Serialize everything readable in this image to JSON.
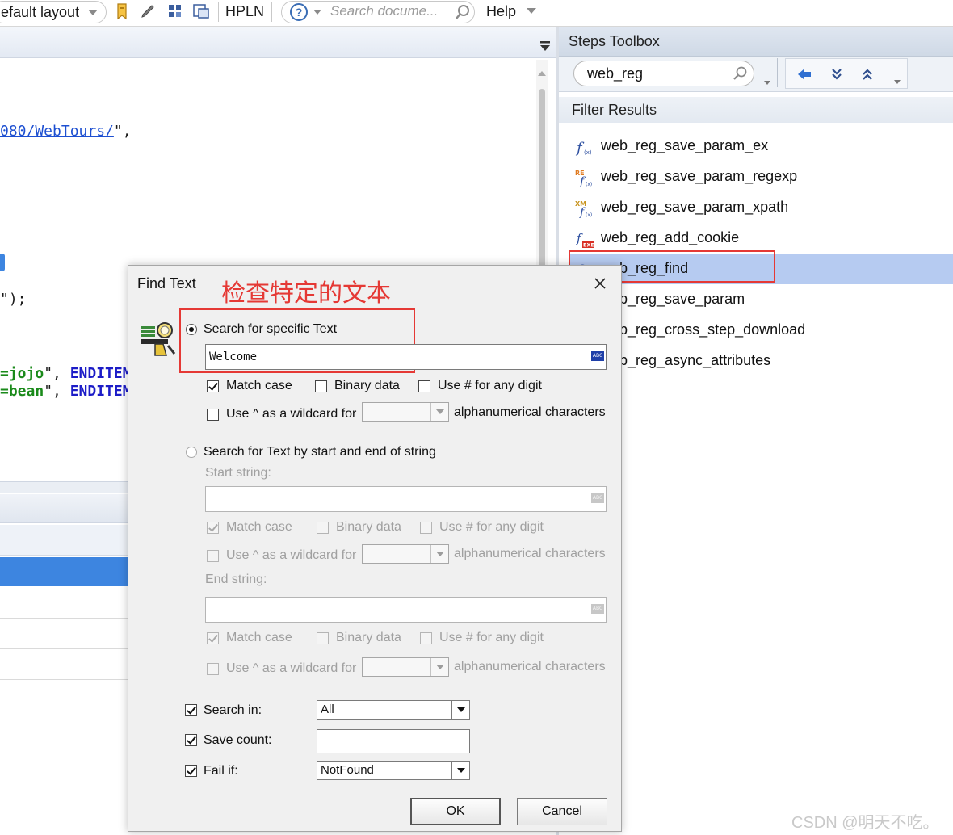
{
  "toolbar": {
    "layout_label": "efault layout",
    "hpln_label": "HPLN",
    "search_placeholder": "Search docume...",
    "help_label": "Help"
  },
  "editor": {
    "code_lines": [
      {
        "link": "080/WebTours/",
        "tail": "\","
      },
      {
        "tail": "\");"
      },
      {
        "g": "=jojo",
        "mid": "\", ",
        "b": "ENDITEM"
      },
      {
        "g": "=bean",
        "mid": "\", ",
        "b": "ENDITEM"
      }
    ]
  },
  "toolbox": {
    "title": "Steps Toolbox",
    "search_value": "web_reg",
    "filter_title": "Filter Results",
    "functions": [
      {
        "label": "web_reg_save_param_ex",
        "icon": "function-icon"
      },
      {
        "label": "web_reg_save_param_regexp",
        "icon": "regexp-function-icon"
      },
      {
        "label": "web_reg_save_param_xpath",
        "icon": "xpath-function-icon"
      },
      {
        "label": "web_reg_add_cookie",
        "icon": "exe-function-icon"
      },
      {
        "label": "web_reg_find",
        "icon": "function-icon",
        "selected": true
      },
      {
        "label": "web_reg_save_param",
        "icon": "function-icon"
      },
      {
        "label": "web_reg_cross_step_download",
        "icon": "function-icon"
      },
      {
        "label": "web_reg_async_attributes",
        "icon": "function-icon"
      }
    ]
  },
  "dialog": {
    "title": "Find Text",
    "annotation": "检查特定的文本",
    "radio_specific": "Search for specific Text",
    "specific_value": "Welcome",
    "match_case": "Match case",
    "binary_data": "Binary data",
    "use_hash": "Use # for any digit",
    "use_caret": "Use ^ as a wildcard for",
    "alnum": "alphanumerical characters",
    "radio_start_end": "Search for Text by start and end of string",
    "start_string": "Start string:",
    "end_string": "End string:",
    "search_in_label": "Search in:",
    "search_in_value": "All",
    "save_count_label": "Save count:",
    "fail_if_label": "Fail if:",
    "fail_if_value": "NotFound",
    "ok": "OK",
    "cancel": "Cancel"
  },
  "watermark": "CSDN @明天不吃。",
  "colors": {
    "annotation_red": "#e53935",
    "selection_blue": "#b6cbf1",
    "accent_blue": "#3d85e0"
  }
}
